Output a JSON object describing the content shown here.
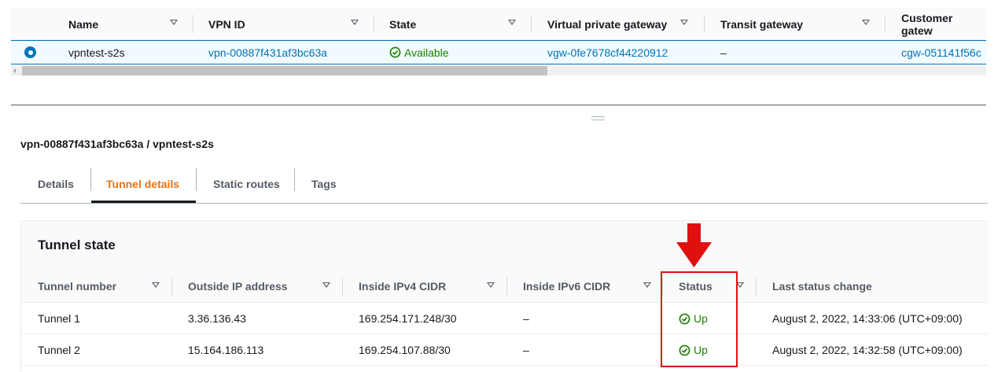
{
  "vpn_table": {
    "columns": [
      "Name",
      "VPN ID",
      "State",
      "Virtual private gateway",
      "Transit gateway",
      "Customer gatew"
    ],
    "row": {
      "name": "vpntest-s2s",
      "vpn_id": "vpn-00887f431af3bc63a",
      "state": "Available",
      "virtual_private_gateway": "vgw-0fe7678cf44220912",
      "transit_gateway": "–",
      "customer_gateway": "cgw-051141f56c"
    }
  },
  "detail": {
    "title": "vpn-00887f431af3bc63a / vpntest-s2s",
    "tabs": [
      "Details",
      "Tunnel details",
      "Static routes",
      "Tags"
    ],
    "active_tab": "Tunnel details"
  },
  "tunnel_state": {
    "title": "Tunnel state",
    "columns": [
      "Tunnel number",
      "Outside IP address",
      "Inside IPv4 CIDR",
      "Inside IPv6 CIDR",
      "Status",
      "Last status change"
    ],
    "rows": [
      {
        "tunnel": "Tunnel 1",
        "outside_ip": "3.36.136.43",
        "inside_ipv4": "169.254.171.248/30",
        "inside_ipv6": "–",
        "status": "Up",
        "last_change": "August 2, 2022, 14:33:06 (UTC+09:00)"
      },
      {
        "tunnel": "Tunnel 2",
        "outside_ip": "15.164.186.113",
        "inside_ipv4": "169.254.107.88/30",
        "inside_ipv6": "–",
        "status": "Up",
        "last_change": "August 2, 2022, 14:32:58 (UTC+09:00)"
      }
    ]
  },
  "colors": {
    "link": "#0073bb",
    "success": "#1d8102",
    "active_tab": "#ec7211",
    "annotation": "#e01010"
  },
  "icons": [
    "sort-caret-icon",
    "radio-selected-icon",
    "check-circle-icon",
    "drag-handle-icon",
    "annotation-arrow-icon"
  ]
}
